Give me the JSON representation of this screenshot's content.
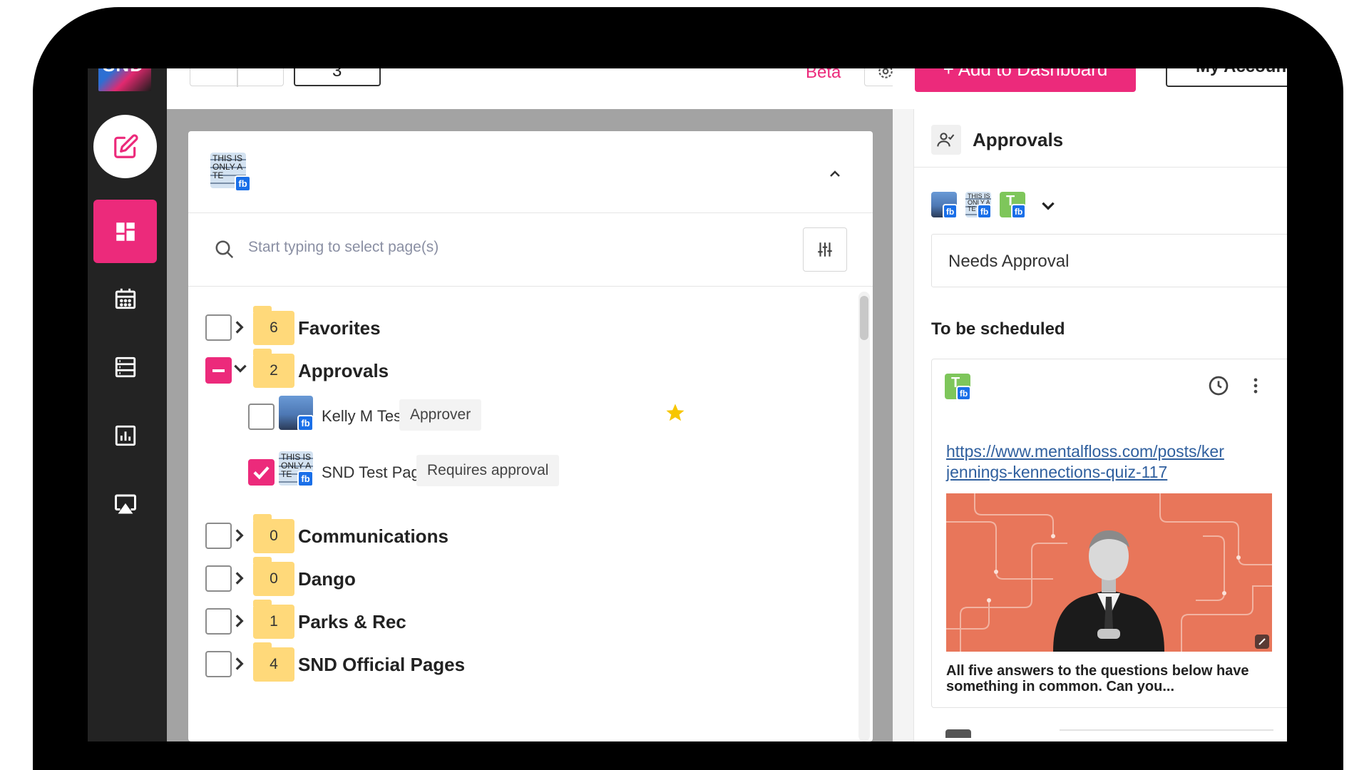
{
  "topbar": {
    "page_count": "3",
    "beta_label": "Beta",
    "add_dashboard_label": "+ Add to Dashboard",
    "account_label": "My Account"
  },
  "sidebar": {
    "logo_text": "SND",
    "items": [
      {
        "name": "compose",
        "icon": "edit-icon"
      },
      {
        "name": "dashboard",
        "icon": "dashboard-icon",
        "active": true
      },
      {
        "name": "calendar",
        "icon": "calendar-icon"
      },
      {
        "name": "list",
        "icon": "list-icon"
      },
      {
        "name": "analytics",
        "icon": "analytics-icon"
      },
      {
        "name": "display",
        "icon": "monitor-icon"
      }
    ]
  },
  "page_selector": {
    "header_avatar_text": "THIS IS ONLY A TE",
    "search_placeholder": "Start typing to select page(s)",
    "groups": [
      {
        "count": "6",
        "label": "Favorites",
        "state": "unchecked",
        "expanded": false
      },
      {
        "count": "2",
        "label": "Approvals",
        "state": "indeterminate",
        "expanded": true,
        "pages": [
          {
            "name": "Kelly M Test",
            "role": "Approver",
            "checked": false,
            "favorite": true,
            "network": "fb"
          },
          {
            "name": "SND Test Page",
            "role": "Requires approval",
            "checked": true,
            "favorite": false,
            "network": "fb"
          }
        ]
      },
      {
        "count": "0",
        "label": "Communications",
        "state": "unchecked",
        "expanded": false
      },
      {
        "count": "0",
        "label": "Dango",
        "state": "unchecked",
        "expanded": false
      },
      {
        "count": "1",
        "label": "Parks & Rec",
        "state": "unchecked",
        "expanded": false
      },
      {
        "count": "4",
        "label": "SND Official Pages",
        "state": "unchecked",
        "expanded": false
      }
    ],
    "network_badge": "fb"
  },
  "approvals": {
    "title": "Approvals",
    "status": "Needs Approval",
    "section": "To be scheduled",
    "avatar_letter": "T",
    "post": {
      "url": "https://www.mentalfloss.com/posts/ken-jennings-kennections-quiz-117",
      "url_line1": "https://www.mentalfloss.com/posts/ker",
      "url_line2": "jennings-kennections-quiz-117",
      "caption": "All five answers to the questions below have something in common. Can you..."
    }
  },
  "colors": {
    "accent": "#ec2a7b",
    "sidebar_bg": "#232323",
    "folder": "#ffd97a",
    "facebook": "#1a6fe8",
    "star": "#f7c600"
  }
}
